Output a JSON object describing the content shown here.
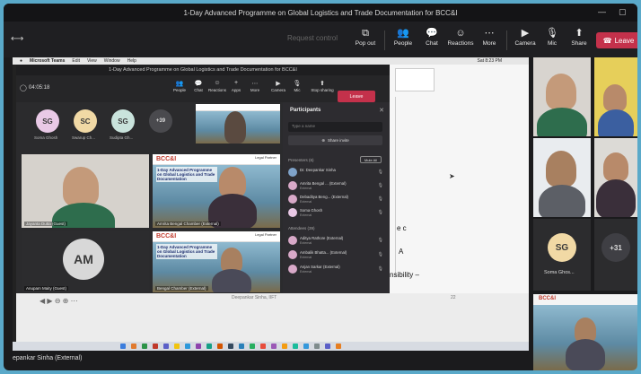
{
  "window": {
    "title": "1-Day Advanced Programme on Global Logistics and Trade Documentation for BCC&I",
    "controls": [
      "—",
      "▢"
    ]
  },
  "toolbar": {
    "request_control": "Request control",
    "buttons": [
      {
        "label": "Pop out",
        "icon": "pop-out-icon",
        "glyph": "⧉"
      },
      {
        "label": "People",
        "icon": "people-icon",
        "glyph": "👥"
      },
      {
        "label": "Chat",
        "icon": "chat-icon",
        "glyph": "💬"
      },
      {
        "label": "Reactions",
        "icon": "reactions-icon",
        "glyph": "☺"
      },
      {
        "label": "More",
        "icon": "more-icon",
        "glyph": "⋯"
      },
      {
        "label": "Camera",
        "icon": "camera-icon",
        "glyph": "▶"
      },
      {
        "label": "Mic",
        "icon": "mic-icon",
        "glyph": "🎙"
      },
      {
        "label": "Share",
        "icon": "share-icon",
        "glyph": "⬆"
      }
    ],
    "leave": "Leave"
  },
  "shared_screen": {
    "mac_menu": [
      "Microsoft Teams",
      "Edit",
      "View",
      "Window",
      "Help"
    ],
    "mac_status": "Sat 8:23 PM",
    "inner_title": "1-Day Advanced Programme on Global Logistics and Trade Documentation for BCC&I",
    "timer": "04:05:18",
    "inner_buttons": [
      {
        "label": "People",
        "glyph": "👥"
      },
      {
        "label": "Chat",
        "glyph": "💬"
      },
      {
        "label": "Reactions",
        "glyph": "☺"
      },
      {
        "label": "Apps",
        "glyph": "+"
      },
      {
        "label": "More",
        "glyph": "⋯"
      },
      {
        "label": "Camera",
        "glyph": "▶"
      },
      {
        "label": "Mic",
        "glyph": "🎙"
      },
      {
        "label": "Stop sharing",
        "glyph": "⬆"
      }
    ],
    "inner_leave": "Leave",
    "small_avatars": [
      {
        "initials": "SG",
        "name": "Soma Ghosh"
      },
      {
        "initials": "SC",
        "name": "Swarup Ch..."
      },
      {
        "initials": "SG",
        "name": "Sudipta Gh..."
      }
    ],
    "overflow": "+39",
    "tiles": {
      "guest1": "Jayanta Dutta (Guest)",
      "avatar_initials": "AM",
      "guest2": "Anupam Maity (Guest)",
      "chamber1": "Amrita Bengal Chamber (External)",
      "chamber2": "Bengal Chamber (External)"
    },
    "slide_text": "1-Day Advanced Programme on Global Logistics and Trade Documentation",
    "slide_logo": "BCC&I",
    "slide_partner": "Legal Partner",
    "participants": {
      "title": "Participants",
      "search_placeholder": "Type a name",
      "share_invite": "Share invite",
      "presenters": "Presenters (6)",
      "mute_all": "Mute All",
      "attendees": "Attendees (39)",
      "people": [
        {
          "name": "Dr. Deepankar Sinha",
          "sub": ""
        },
        {
          "name": "Amrita Bengal ... (External)",
          "sub": "External"
        },
        {
          "name": "Debaditya Beng... (External)",
          "sub": "External"
        },
        {
          "name": "Soma Ghosh",
          "sub": "External"
        },
        {
          "name": "Aditya Rathore (External)",
          "sub": "External"
        },
        {
          "name": "Ambalik Bhatta... (External)",
          "sub": "External"
        },
        {
          "name": "Anjan Sarkar (External)",
          "sub": "External"
        }
      ]
    },
    "doc_text": [
      "e c",
      "A",
      "nsibility –"
    ],
    "doc_footer": "Deepankar Sinha, IIFT",
    "doc_page": "22"
  },
  "presenter_name": "epankar Sinha (External)",
  "gallery": {
    "sg_initials": "SG",
    "sg_name": "Soma Ghos...",
    "overflow": "+31"
  },
  "colors": {
    "leave_red": "#c4314b",
    "teams_dark": "#1f1f22",
    "sg_avatar": "#f1d9a5"
  }
}
